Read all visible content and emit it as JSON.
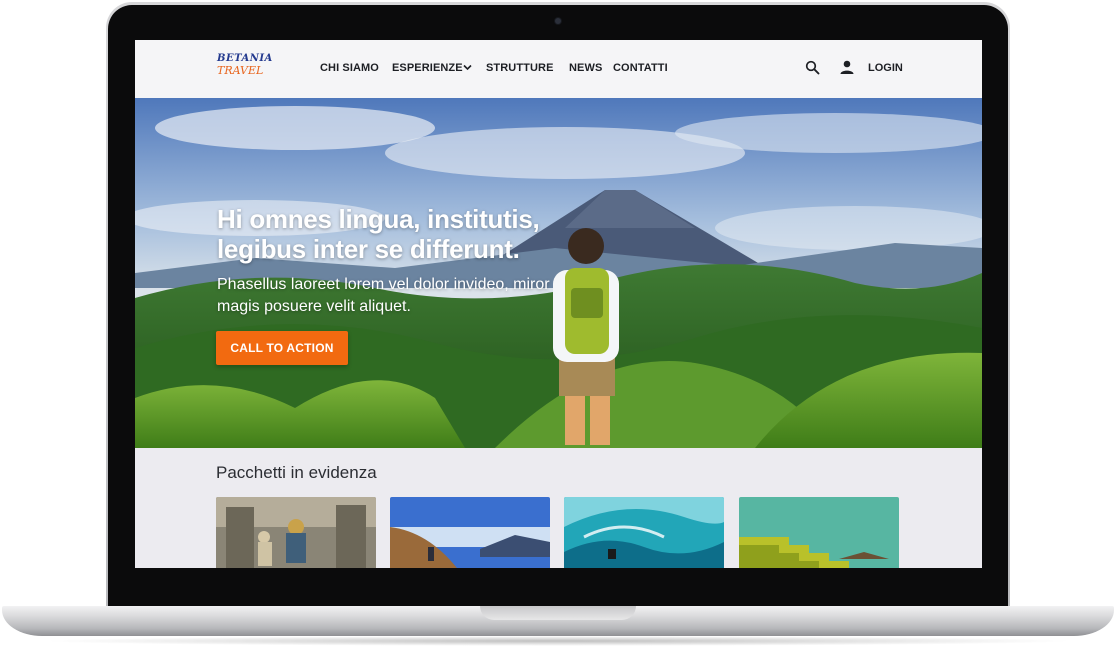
{
  "header": {
    "logo": {
      "line1": "BETANIA",
      "line2": "TRAVEL"
    },
    "nav": [
      {
        "label": "CHI SIAMO"
      },
      {
        "label": "ESPERIENZE"
      },
      {
        "label": "STRUTTURE"
      },
      {
        "label": "NEWS"
      },
      {
        "label": "CONTATTI"
      }
    ],
    "search_icon": "search-icon",
    "user_icon": "user-icon",
    "login_label": "LOGIN"
  },
  "hero": {
    "title": "Hi omnes lingua, institutis, legibus inter se differunt.",
    "subtitle": "Phasellus laoreet lorem vel dolor invideo, miror magis posuere velit aliquet.",
    "cta_label": "CALL TO ACTION"
  },
  "packages": {
    "title": "Pacchetti in evidenza",
    "cards": [
      {
        "image": "temple-performer"
      },
      {
        "image": "mountain-hiker"
      },
      {
        "image": "ocean-wave-surfer"
      },
      {
        "image": "rice-terraces"
      }
    ]
  },
  "colors": {
    "accent": "#f26a10",
    "logo_blue": "#243a8f",
    "logo_orange": "#e8651e",
    "nav_background": "#f5f5f7",
    "section_background": "#ecebf0"
  }
}
